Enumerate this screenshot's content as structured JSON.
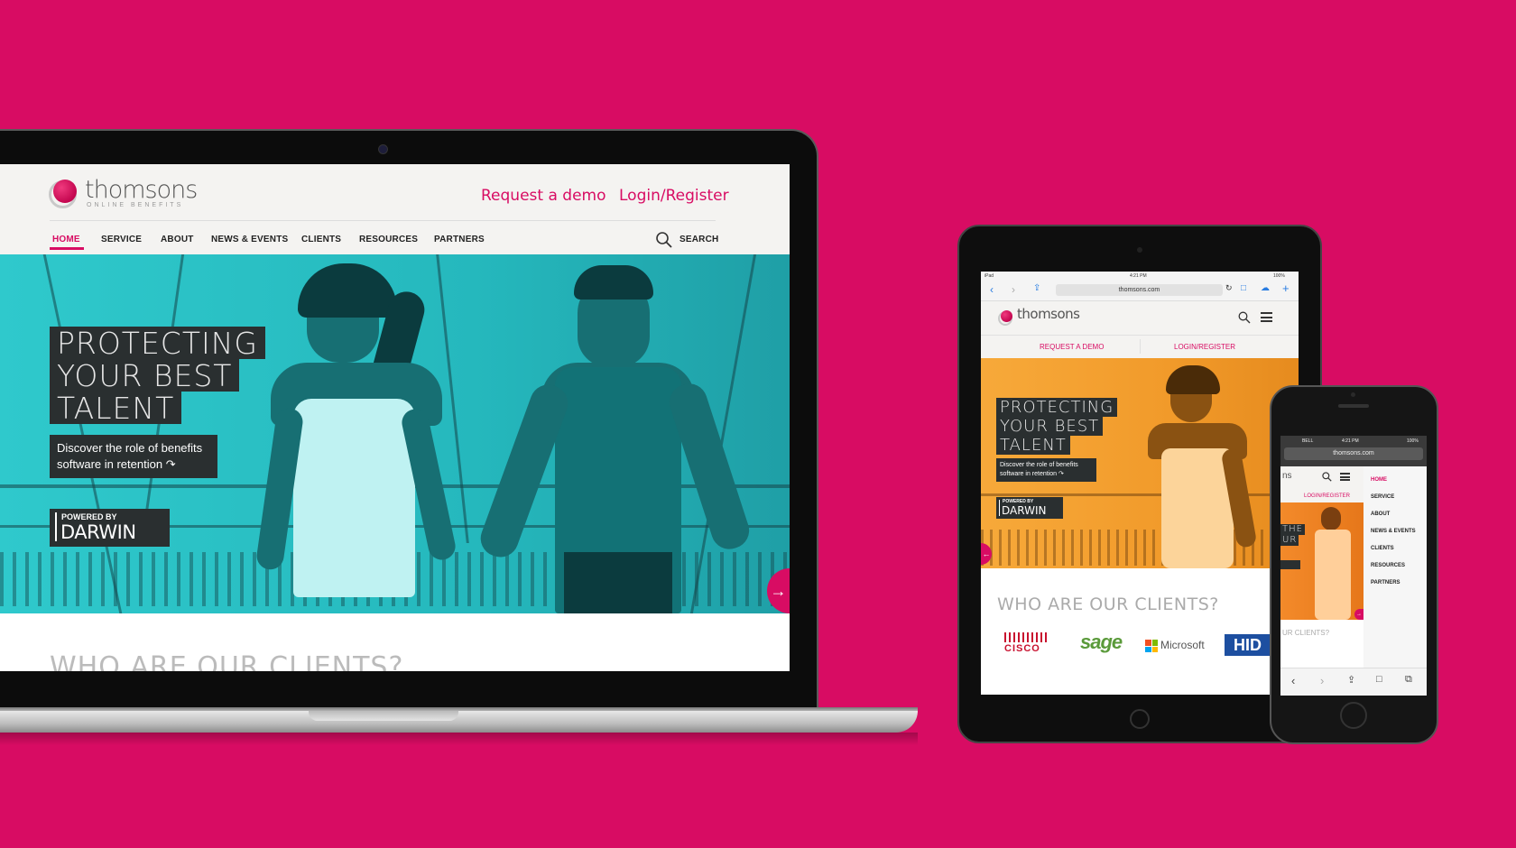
{
  "brand": {
    "name": "thomsons",
    "tagline": "ONLINE BENEFITS",
    "accent": "#d80c63"
  },
  "desktop": {
    "links": {
      "demo": "Request a demo",
      "login": "Login/Register"
    },
    "nav": [
      "HOME",
      "SERVICE",
      "ABOUT",
      "NEWS & EVENTS",
      "CLIENTS",
      "RESOURCES",
      "PARTNERS"
    ],
    "search_label": "SEARCH",
    "hero": {
      "line1": "PROTECTING",
      "line2": "YOUR BEST",
      "line3": "TALENT",
      "sub1": "Discover the role of benefits",
      "sub2": "software in retention",
      "powered_by": "POWERED BY",
      "product": "DARWIN"
    },
    "clients_title": "WHO ARE OUR CLIENTS?"
  },
  "tablet": {
    "status_left": "iPad",
    "status_time": "4:21 PM",
    "status_battery": "100%",
    "url": "thomsons.com",
    "links": {
      "demo": "REQUEST A DEMO",
      "login": "LOGIN/REGISTER"
    },
    "hero": {
      "line1": "PROTECTING",
      "line2": "YOUR BEST",
      "line3": "TALENT",
      "sub1": "Discover the role of benefits",
      "sub2": "software in retention",
      "powered_by": "POWERED BY",
      "product": "DARWIN"
    },
    "clients_title": "WHO ARE OUR CLIENTS?",
    "clients": [
      "CISCO",
      "sage",
      "Microsoft",
      "HID"
    ]
  },
  "phone": {
    "carrier": "BELL",
    "time": "4:21 PM",
    "battery": "100%",
    "url": "thomsons.com",
    "login": "LOGIN/REGISTER",
    "hero_fragment1": "THE",
    "hero_fragment2": "UR",
    "clients_fragment": "UR CLIENTS?",
    "menu": [
      "HOME",
      "SERVICE",
      "ABOUT",
      "NEWS & EVENTS",
      "CLIENTS",
      "RESOURCES",
      "PARTNERS"
    ]
  }
}
